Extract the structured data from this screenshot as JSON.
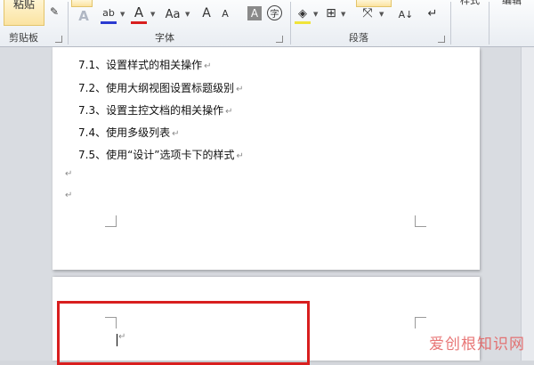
{
  "ribbon": {
    "clipboard": {
      "paste_label": "粘贴",
      "group_label": "剪贴板"
    },
    "font": {
      "group_label": "字体",
      "font_size_button": "Aa",
      "grow_font": "A",
      "shrink_font": "A",
      "char_border": "A",
      "phonetic": "字"
    },
    "paragraph": {
      "group_label": "段落"
    },
    "styles": {
      "label": "样式"
    },
    "editing": {
      "label": "编辑"
    }
  },
  "document": {
    "toc_lines": [
      "7.1、设置样式的相关操作",
      "7.2、使用大纲视图设置标题级别",
      "7.3、设置主控文档的相关操作",
      "7.4、使用多级列表",
      "7.5、使用“设计”选项卡下的样式"
    ],
    "paragraph_mark": "↵"
  },
  "watermark": "爱创根知识网"
}
